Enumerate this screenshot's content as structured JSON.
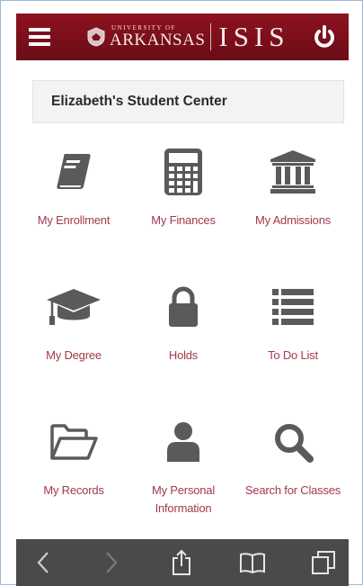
{
  "header": {
    "university_small": "UNIVERSITY OF",
    "university_big": "ARKANSAS",
    "system_name": "ISIS",
    "menu_icon": "hamburger-menu-icon",
    "power_icon": "power-icon",
    "brand_color": "#7a0f1c"
  },
  "page": {
    "title": "Elizabeth's Student Center"
  },
  "tiles": [
    {
      "label": "My Enrollment",
      "icon": "book-icon"
    },
    {
      "label": "My Finances",
      "icon": "calculator-icon"
    },
    {
      "label": "My Admissions",
      "icon": "institution-icon"
    },
    {
      "label": "My Degree",
      "icon": "graduation-cap-icon"
    },
    {
      "label": "Holds",
      "icon": "lock-icon"
    },
    {
      "label": "To Do List",
      "icon": "list-icon"
    },
    {
      "label": "My Records",
      "icon": "folder-open-icon"
    },
    {
      "label": "My Personal Information",
      "icon": "user-icon"
    },
    {
      "label": "Search for Classes",
      "icon": "search-icon"
    }
  ],
  "toolbar": {
    "back_icon": "chevron-left-icon",
    "forward_icon": "chevron-right-icon",
    "share_icon": "share-icon",
    "bookmarks_icon": "bookmarks-icon",
    "tabs_icon": "tabs-icon"
  },
  "colors": {
    "label": "#a13a4c",
    "icon": "#5a5a5a",
    "toolbar": "#4a4a4c"
  }
}
